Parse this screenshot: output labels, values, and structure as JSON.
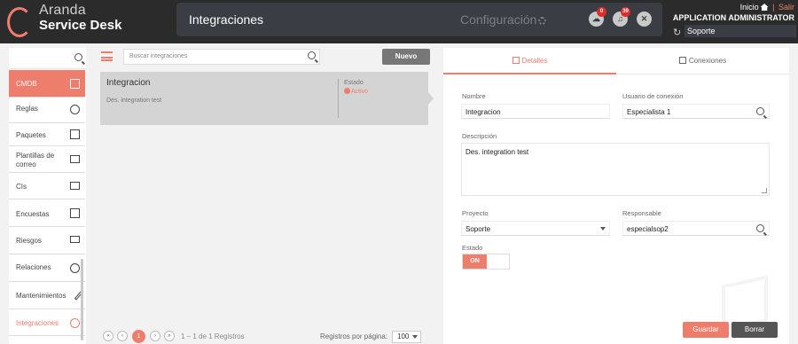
{
  "header": {
    "brand": "Aranda",
    "product": "Service Desk",
    "page_title": "Integraciones",
    "config_label": "Configuración",
    "cloud_badge": "0",
    "bell_badge": "39",
    "home_label": "Inicio",
    "logout_label": "Salir",
    "user_role": "APPLICATION ADMINISTRATOR",
    "project": "Soporte"
  },
  "sidebar": {
    "items": [
      {
        "label": "CMDB",
        "icon": "copy-icon"
      },
      {
        "label": "Reglas",
        "icon": "compass-icon"
      },
      {
        "label": "Paquetes",
        "icon": "box-icon"
      },
      {
        "label": "Plantillas de correo",
        "icon": "envelope-icon"
      },
      {
        "label": "CIs",
        "icon": "laptop-icon"
      },
      {
        "label": "Encuestas",
        "icon": "survey-icon"
      },
      {
        "label": "Riesgos",
        "icon": "barrier-icon"
      },
      {
        "label": "Relaciones",
        "icon": "network-icon"
      },
      {
        "label": "Mantenimientos",
        "icon": "wrench-icon"
      },
      {
        "label": "Integraciones",
        "icon": "integration-icon"
      }
    ]
  },
  "list": {
    "search_placeholder": "Buscar integraciones",
    "new_label": "Nuevo",
    "items": [
      {
        "name": "Integracion",
        "description": "Des. integration test",
        "state_label": "Estado",
        "state": "Activo"
      }
    ],
    "pagination": {
      "first": "«",
      "prev": "‹",
      "current": "1",
      "next": "›",
      "last": "»",
      "range": "1 – 1 de 1 Registros",
      "per_page_label": "Registros por página:",
      "per_page": "100"
    }
  },
  "detail": {
    "tabs": {
      "details": "Detalles",
      "connections": "Conexiones"
    },
    "name_label": "Nombre",
    "name_value": "Integracion",
    "user_label": "Usuario de conexión",
    "user_value": "Especialista 1",
    "description_label": "Descripción",
    "description_value": "Des. integration test",
    "project_label": "Proyecto",
    "project_value": "Soporte",
    "responsible_label": "Responsable",
    "responsible_value": "especialsop2",
    "state_label": "Estado",
    "toggle_on": "ON",
    "save_label": "Guardar",
    "delete_label": "Borrar"
  },
  "colors": {
    "accent": "#ef7d6c",
    "topbar": "#2b2b2b",
    "badge": "#e02c2c"
  }
}
